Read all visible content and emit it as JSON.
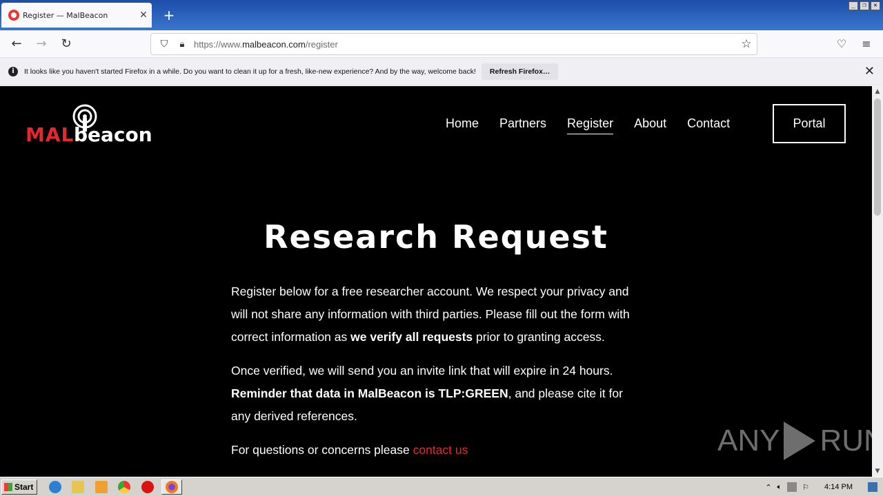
{
  "browser": {
    "tab_title": "Register — MalBeacon",
    "url_host": "https://www.",
    "url_domain": "malbeacon.com",
    "url_path": "/register",
    "notification": "It looks like you haven't started Firefox in a while. Do you want to clean it up for a fresh, like-new experience? And by the way, welcome back!",
    "notification_button": "Refresh Firefox…"
  },
  "site": {
    "logo_mal": "MAL",
    "logo_beacon": "beacon",
    "nav": [
      "Home",
      "Partners",
      "Register",
      "About",
      "Contact"
    ],
    "active_nav": "Register",
    "portal_label": "Portal",
    "heading": "Research Request",
    "para1_a": "Register below for a free researcher account. We respect your privacy and will not share any information with third parties. Please fill out the form with correct information as ",
    "para1_bold": "we verify all requests",
    "para1_b": " prior to granting access.",
    "para2_a": "Once verified, we will send you an invite link that will expire in 24 hours. ",
    "para2_bold": "Reminder that data in MalBeacon is TLP:GREEN",
    "para2_b": ", and please cite it for any derived references.",
    "para3_a": "For questions or concerns please ",
    "para3_link": "contact us",
    "watermark_left": "ANY",
    "watermark_right": "RUN"
  },
  "taskbar": {
    "start_label": "Start",
    "clock": "4:14 PM"
  },
  "colors": {
    "brand_red": "#e8262b",
    "page_bg": "#000000"
  }
}
